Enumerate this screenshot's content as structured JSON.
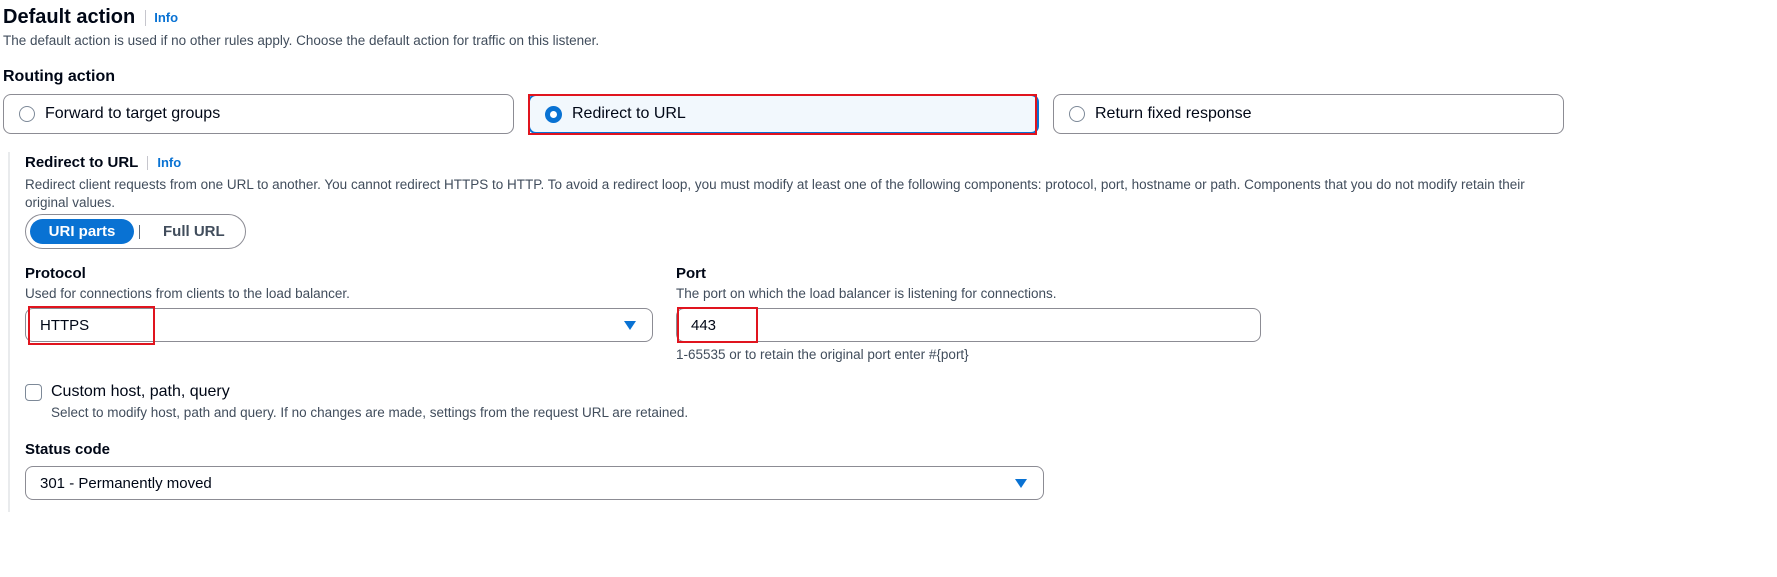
{
  "header": {
    "title": "Default action",
    "info": "Info",
    "description": "The default action is used if no other rules apply. Choose the default action for traffic on this listener."
  },
  "routing_action": {
    "label": "Routing action",
    "options": [
      {
        "label": "Forward to target groups",
        "selected": false
      },
      {
        "label": "Redirect to URL",
        "selected": true
      },
      {
        "label": "Return fixed response",
        "selected": false
      }
    ]
  },
  "redirect": {
    "title": "Redirect to URL",
    "info": "Info",
    "description": "Redirect client requests from one URL to another. You cannot redirect HTTPS to HTTP. To avoid a redirect loop, you must modify at least one of the following components: protocol, port, hostname or path. Components that you do not modify retain their original values.",
    "segment": {
      "options": [
        "URI parts",
        "Full URL"
      ],
      "selected": "URI parts"
    },
    "protocol": {
      "label": "Protocol",
      "description": "Used for connections from clients to the load balancer.",
      "value": "HTTPS"
    },
    "port": {
      "label": "Port",
      "description": "The port on which the load balancer is listening for connections.",
      "value": "443",
      "hint": "1-65535 or to retain the original port enter #{port}"
    },
    "custom": {
      "label": "Custom host, path, query",
      "description": "Select to modify host, path and query. If no changes are made, settings from the request URL are retained.",
      "checked": false
    },
    "status_code": {
      "label": "Status code",
      "value": "301 - Permanently moved"
    }
  },
  "colors": {
    "accent": "#0972d3",
    "highlight": "#e0141e",
    "selected_bg": "#f2f8fd"
  }
}
